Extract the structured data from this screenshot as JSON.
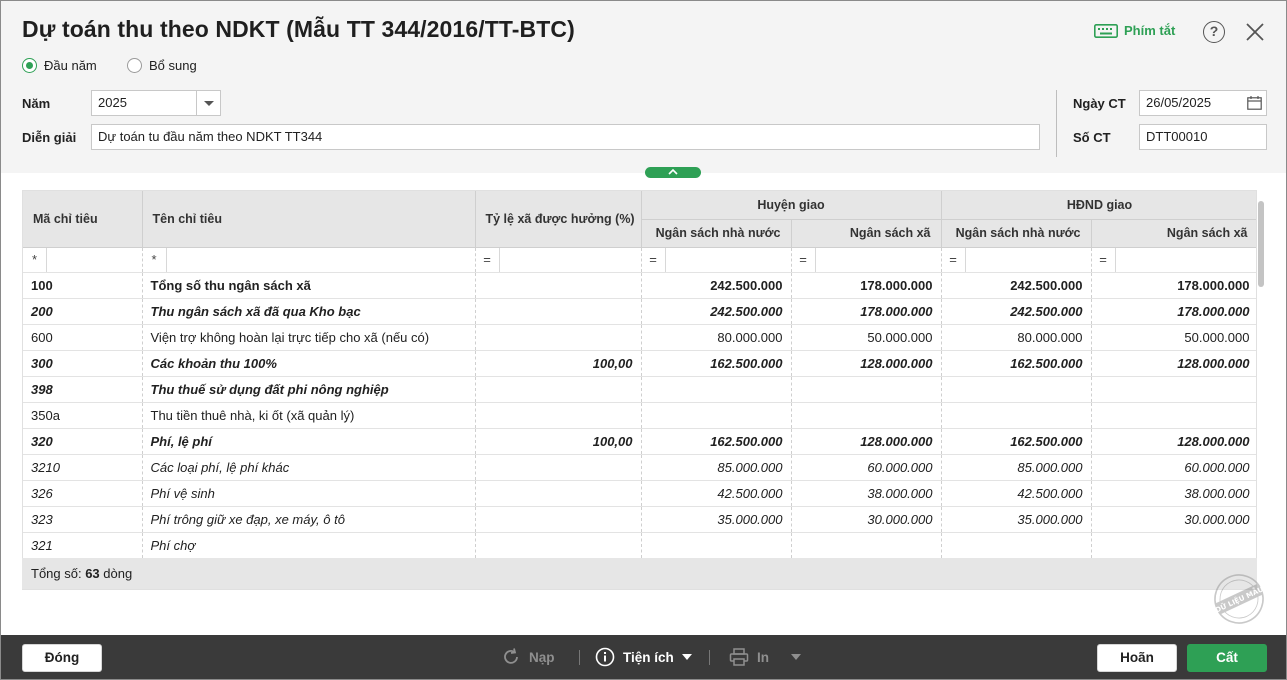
{
  "window": {
    "title": "Dự toán thu theo NDKT (Mẫu TT 344/2016/TT-BTC)",
    "hotkey_label": "Phím tắt"
  },
  "mode": {
    "option1": "Đầu năm",
    "option2": "Bổ sung",
    "selected": "Đầu năm"
  },
  "form": {
    "year_label": "Năm",
    "year_value": "2025",
    "desc_label": "Diễn giải",
    "desc_value": "Dự toán tu đầu năm theo NDKT TT344",
    "date_label": "Ngày CT",
    "date_value": "26/05/2025",
    "docno_label": "Số CT",
    "docno_value": "DTT00010"
  },
  "grid": {
    "headers": {
      "code": "Mã chỉ tiêu",
      "name": "Tên chỉ tiêu",
      "ratio": "Tỷ lệ xã được hưởng (%)",
      "group1": "Huyện giao",
      "group2": "HĐND giao",
      "sub_state": "Ngân sách nhà nước",
      "sub_commune": "Ngân sách xã"
    },
    "filter": {
      "text_op": "*",
      "num_op": "="
    },
    "rows": [
      {
        "style": "b",
        "code": "100",
        "name": "Tổng số thu ngân sách xã",
        "ratio": "",
        "h_state": "242.500.000",
        "h_commune": "178.000.000",
        "c_state": "242.500.000",
        "c_commune": "178.000.000"
      },
      {
        "style": "bi",
        "code": "200",
        "name": "Thu ngân sách xã đã qua Kho bạc",
        "ratio": "",
        "h_state": "242.500.000",
        "h_commune": "178.000.000",
        "c_state": "242.500.000",
        "c_commune": "178.000.000"
      },
      {
        "style": "n",
        "code": "600",
        "name": "Viện trợ không hoàn lại trực tiếp cho xã (nếu có)",
        "ratio": "",
        "h_state": "80.000.000",
        "h_commune": "50.000.000",
        "c_state": "80.000.000",
        "c_commune": "50.000.000"
      },
      {
        "style": "bi",
        "code": "300",
        "name": "Các khoản thu 100%",
        "ratio": "100,00",
        "h_state": "162.500.000",
        "h_commune": "128.000.000",
        "c_state": "162.500.000",
        "c_commune": "128.000.000"
      },
      {
        "style": "bi",
        "code": "398",
        "name": "Thu thuế sử dụng đất phi nông nghiệp",
        "ratio": "",
        "h_state": "",
        "h_commune": "",
        "c_state": "",
        "c_commune": ""
      },
      {
        "style": "n",
        "code": "350a",
        "name": "Thu tiền thuê nhà, ki ốt (xã quản lý)",
        "ratio": "",
        "h_state": "",
        "h_commune": "",
        "c_state": "",
        "c_commune": ""
      },
      {
        "style": "bi",
        "code": "320",
        "name": "Phí, lệ phí",
        "ratio": "100,00",
        "h_state": "162.500.000",
        "h_commune": "128.000.000",
        "c_state": "162.500.000",
        "c_commune": "128.000.000"
      },
      {
        "style": "i",
        "code": "3210",
        "name": "Các loại phí, lệ phí khác",
        "ratio": "",
        "h_state": "85.000.000",
        "h_commune": "60.000.000",
        "c_state": "85.000.000",
        "c_commune": "60.000.000"
      },
      {
        "style": "i",
        "code": "326",
        "name": "Phí vệ sinh",
        "ratio": "",
        "h_state": "42.500.000",
        "h_commune": "38.000.000",
        "c_state": "42.500.000",
        "c_commune": "38.000.000"
      },
      {
        "style": "i",
        "code": "323",
        "name": "Phí trông giữ xe đạp, xe máy, ô tô",
        "ratio": "",
        "h_state": "35.000.000",
        "h_commune": "30.000.000",
        "c_state": "35.000.000",
        "c_commune": "30.000.000"
      },
      {
        "style": "i",
        "code": "321",
        "name": "Phí chợ",
        "ratio": "",
        "h_state": "",
        "h_commune": "",
        "c_state": "",
        "c_commune": ""
      }
    ],
    "footer": {
      "prefix": "Tổng số: ",
      "count": "63",
      "suffix": " dòng"
    }
  },
  "watermark": "DỮ LIỆU MẪU",
  "toolbar": {
    "close_label": "Đóng",
    "reload_label": "Nạp",
    "utilities_label": "Tiện ích",
    "print_label": "In",
    "cancel_label": "Hoãn",
    "save_label": "Cất"
  },
  "colors": {
    "accent": "#2ea055",
    "bottom_bar": "#3a3a3a"
  }
}
